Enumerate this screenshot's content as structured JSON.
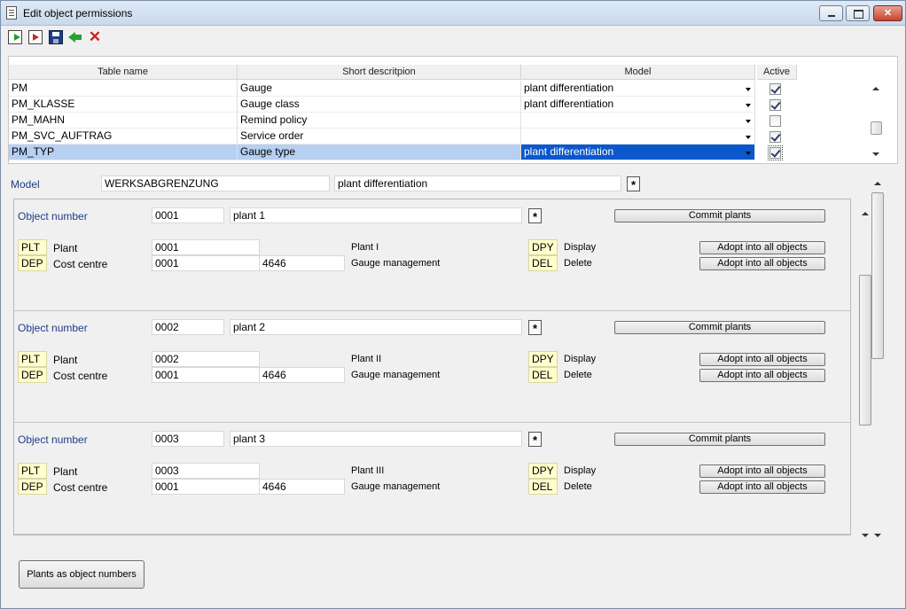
{
  "window": {
    "title": "Edit object permissions",
    "controls": {
      "minimize": "",
      "maximize": "",
      "close": "✕"
    }
  },
  "toolbar": {
    "cancel_glyph": "✕"
  },
  "table": {
    "columns": [
      "Table name",
      "Short descritpion",
      "Model",
      "Active"
    ],
    "rows": [
      {
        "name": "PM",
        "desc": "Gauge",
        "model": "plant differentiation",
        "active": true
      },
      {
        "name": "PM_KLASSE",
        "desc": "Gauge class",
        "model": "plant differentiation",
        "active": true
      },
      {
        "name": "PM_MAHN",
        "desc": "Remind policy",
        "model": "",
        "active": false
      },
      {
        "name": "PM_SVC_AUFTRAG",
        "desc": "Service order",
        "model": "",
        "active": true
      },
      {
        "name": "PM_TYP",
        "desc": "Gauge type",
        "model": "plant differentiation",
        "active": true,
        "selected": true
      }
    ]
  },
  "model": {
    "label": "Model",
    "code": "WERKSABGRENZUNG",
    "name": "plant differentiation",
    "star": "*"
  },
  "objects": [
    {
      "label": "Object number",
      "number": "0001",
      "name": "plant 1",
      "star": "*",
      "commit": "Commit plants",
      "plant_code": "PLT",
      "plant_label": "Plant",
      "plant_value": "0001",
      "plant_name": "Plant I",
      "dep_code": "DEP",
      "dep_label": "Cost centre",
      "dep_value": "0001",
      "dep_value2": "4646",
      "dep_name": "Gauge management",
      "dpy_code": "DPY",
      "dpy_label": "Display",
      "del_code": "DEL",
      "del_label": "Delete",
      "adopt1": "Adopt into all objects",
      "adopt2": "Adopt into all objects"
    },
    {
      "label": "Object number",
      "number": "0002",
      "name": "plant 2",
      "star": "*",
      "commit": "Commit plants",
      "plant_code": "PLT",
      "plant_label": "Plant",
      "plant_value": "0002",
      "plant_name": "Plant II",
      "dep_code": "DEP",
      "dep_label": "Cost centre",
      "dep_value": "0001",
      "dep_value2": "4646",
      "dep_name": "Gauge management",
      "dpy_code": "DPY",
      "dpy_label": "Display",
      "del_code": "DEL",
      "del_label": "Delete",
      "adopt1": "Adopt into all objects",
      "adopt2": "Adopt into all objects"
    },
    {
      "label": "Object number",
      "number": "0003",
      "name": "plant 3",
      "star": "*",
      "commit": "Commit plants",
      "plant_code": "PLT",
      "plant_label": "Plant",
      "plant_value": "0003",
      "plant_name": "Plant III",
      "dep_code": "DEP",
      "dep_label": "Cost centre",
      "dep_value": "0001",
      "dep_value2": "4646",
      "dep_name": "Gauge management",
      "dpy_code": "DPY",
      "dpy_label": "Display",
      "del_code": "DEL",
      "del_label": "Delete",
      "adopt1": "Adopt into all objects",
      "adopt2": "Adopt into all objects"
    }
  ],
  "footer": {
    "plants_button": "Plants as object numbers"
  }
}
